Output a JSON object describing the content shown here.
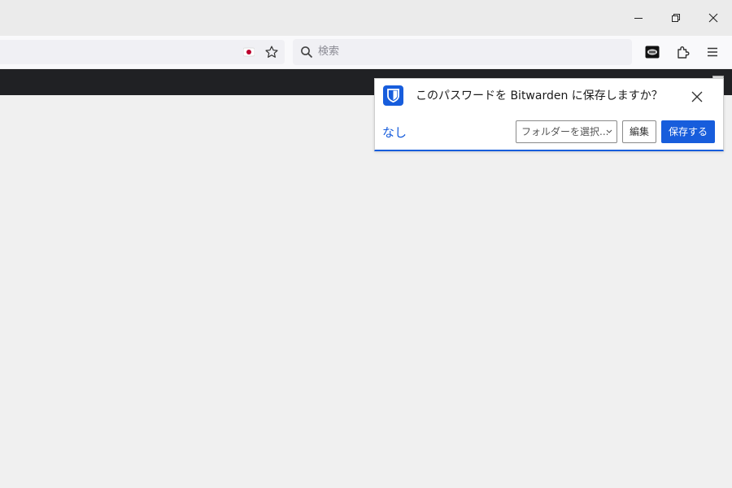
{
  "window": {
    "controls": [
      "minimize",
      "restore",
      "close"
    ]
  },
  "toolbar": {
    "search": {
      "placeholder": "検索"
    },
    "icons": [
      "japan-flag-icon",
      "bookmark-star-icon",
      "search-icon",
      "bitwarden-extension-icon",
      "extensions-icon",
      "menu-icon"
    ]
  },
  "notification": {
    "message": "このパスワードを Bitwarden に保存しますか？",
    "never_label": "なし",
    "folder_select": "フォルダーを選択...",
    "edit_label": "編集",
    "save_label": "保存する"
  },
  "colors": {
    "accent": "#175ddc",
    "darkbar": "#202124",
    "page_bg": "#f0f0f0"
  }
}
